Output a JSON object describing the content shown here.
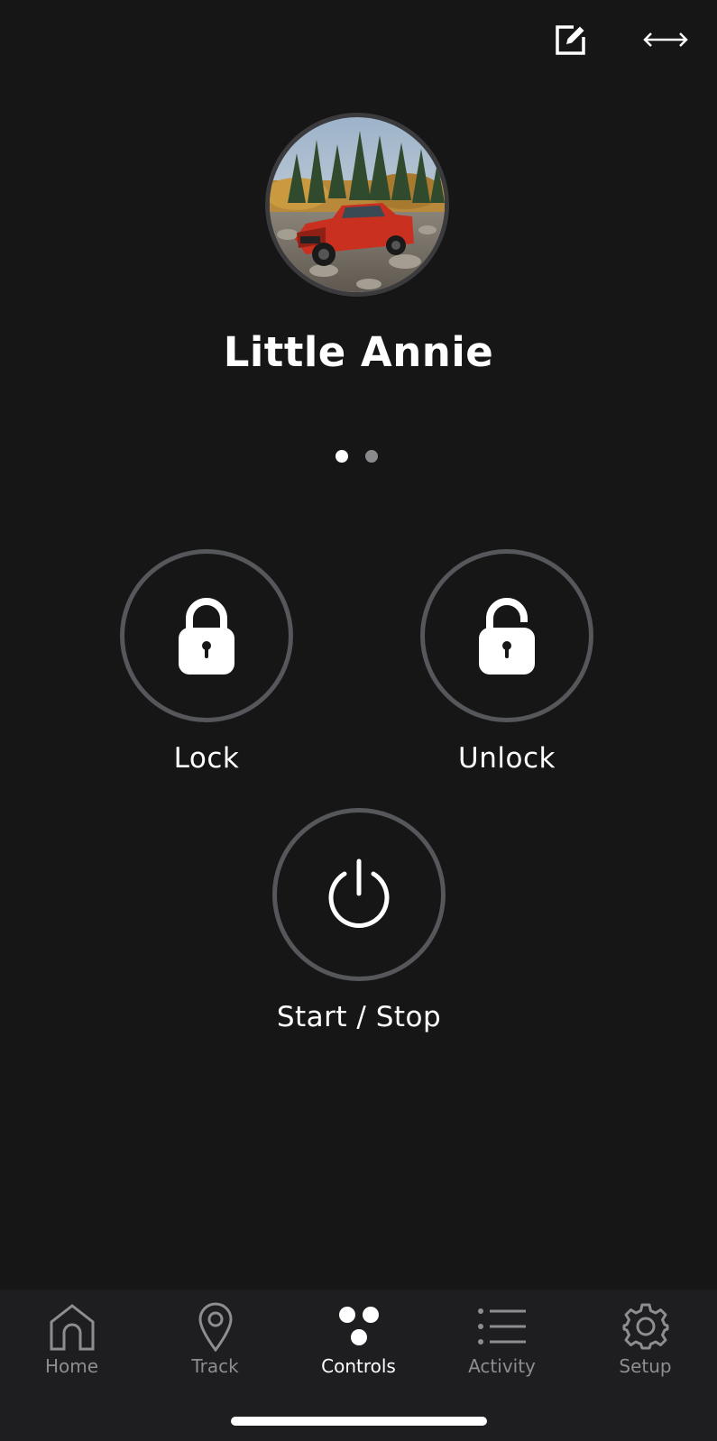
{
  "header": {
    "edit_icon": "edit-icon",
    "swap_icon": "swap-vehicle-icon"
  },
  "vehicle": {
    "name": "Little Annie",
    "photo_description_icon": "vehicle-photo"
  },
  "pager": {
    "page_count": 2,
    "active_index": 0
  },
  "controls": {
    "lock_label": "Lock",
    "unlock_label": "Unlock",
    "start_stop_label": "Start / Stop"
  },
  "tabbar": {
    "active_tab": "Controls",
    "tabs": [
      {
        "label": "Home",
        "icon": "home-icon"
      },
      {
        "label": "Track",
        "icon": "location-pin-icon"
      },
      {
        "label": "Controls",
        "icon": "controls-dots-icon"
      },
      {
        "label": "Activity",
        "icon": "list-icon"
      },
      {
        "label": "Setup",
        "icon": "gear-icon"
      }
    ]
  },
  "colors": {
    "background": "#161617",
    "tabbar_background": "#1e1e20",
    "ring": "#56575a",
    "inactive_tab": "#8e8e92",
    "active": "#ffffff"
  }
}
